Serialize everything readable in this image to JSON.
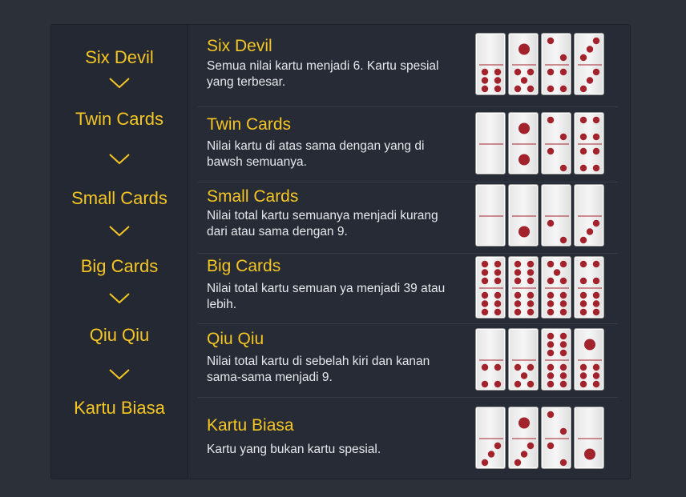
{
  "sidebar": {
    "items": [
      {
        "label": "Six Devil"
      },
      {
        "label": "Twin Cards"
      },
      {
        "label": "Small Cards"
      },
      {
        "label": "Big Cards"
      },
      {
        "label": "Qiu Qiu"
      },
      {
        "label": "Kartu Biasa"
      }
    ]
  },
  "rows": [
    {
      "title": "Six Devil",
      "desc": "Semua nilai kartu menjadi 6. Kartu spesial yang terbesar.",
      "dominoes": [
        [
          0,
          6
        ],
        [
          1,
          5
        ],
        [
          2,
          4
        ],
        [
          3,
          3
        ]
      ]
    },
    {
      "title": "Twin Cards",
      "desc": "Nilai kartu di atas sama dengan yang di bawsh semuanya.",
      "dominoes": [
        [
          0,
          0
        ],
        [
          1,
          1
        ],
        [
          2,
          2
        ],
        [
          4,
          4
        ]
      ]
    },
    {
      "title": "Small Cards",
      "desc": "Nilai total kartu semuanya menjadi kurang dari atau sama dengan 9.",
      "dominoes": [
        [
          0,
          0
        ],
        [
          0,
          1
        ],
        [
          0,
          2
        ],
        [
          0,
          3
        ]
      ]
    },
    {
      "title": "Big Cards",
      "desc": "Nilai total kartu semuan ya menjadi 39 atau lebih.",
      "dominoes": [
        [
          6,
          6
        ],
        [
          6,
          6
        ],
        [
          5,
          6
        ],
        [
          4,
          6
        ]
      ]
    },
    {
      "title": "Qiu Qiu",
      "desc": "Nilai total kartu di sebelah kiri dan kanan sama-sama menjadi 9.",
      "dominoes": [
        [
          0,
          4
        ],
        [
          0,
          5
        ],
        [
          6,
          6
        ],
        [
          1,
          6
        ]
      ]
    },
    {
      "title": "Kartu Biasa",
      "desc": "Kartu yang bukan kartu spesial.",
      "dominoes": [
        [
          0,
          3
        ],
        [
          1,
          3
        ],
        [
          2,
          2
        ],
        [
          0,
          1
        ]
      ]
    }
  ],
  "colors": {
    "accent": "#f5c623",
    "pip": "#a3232d",
    "text": "#e6e8ec"
  }
}
